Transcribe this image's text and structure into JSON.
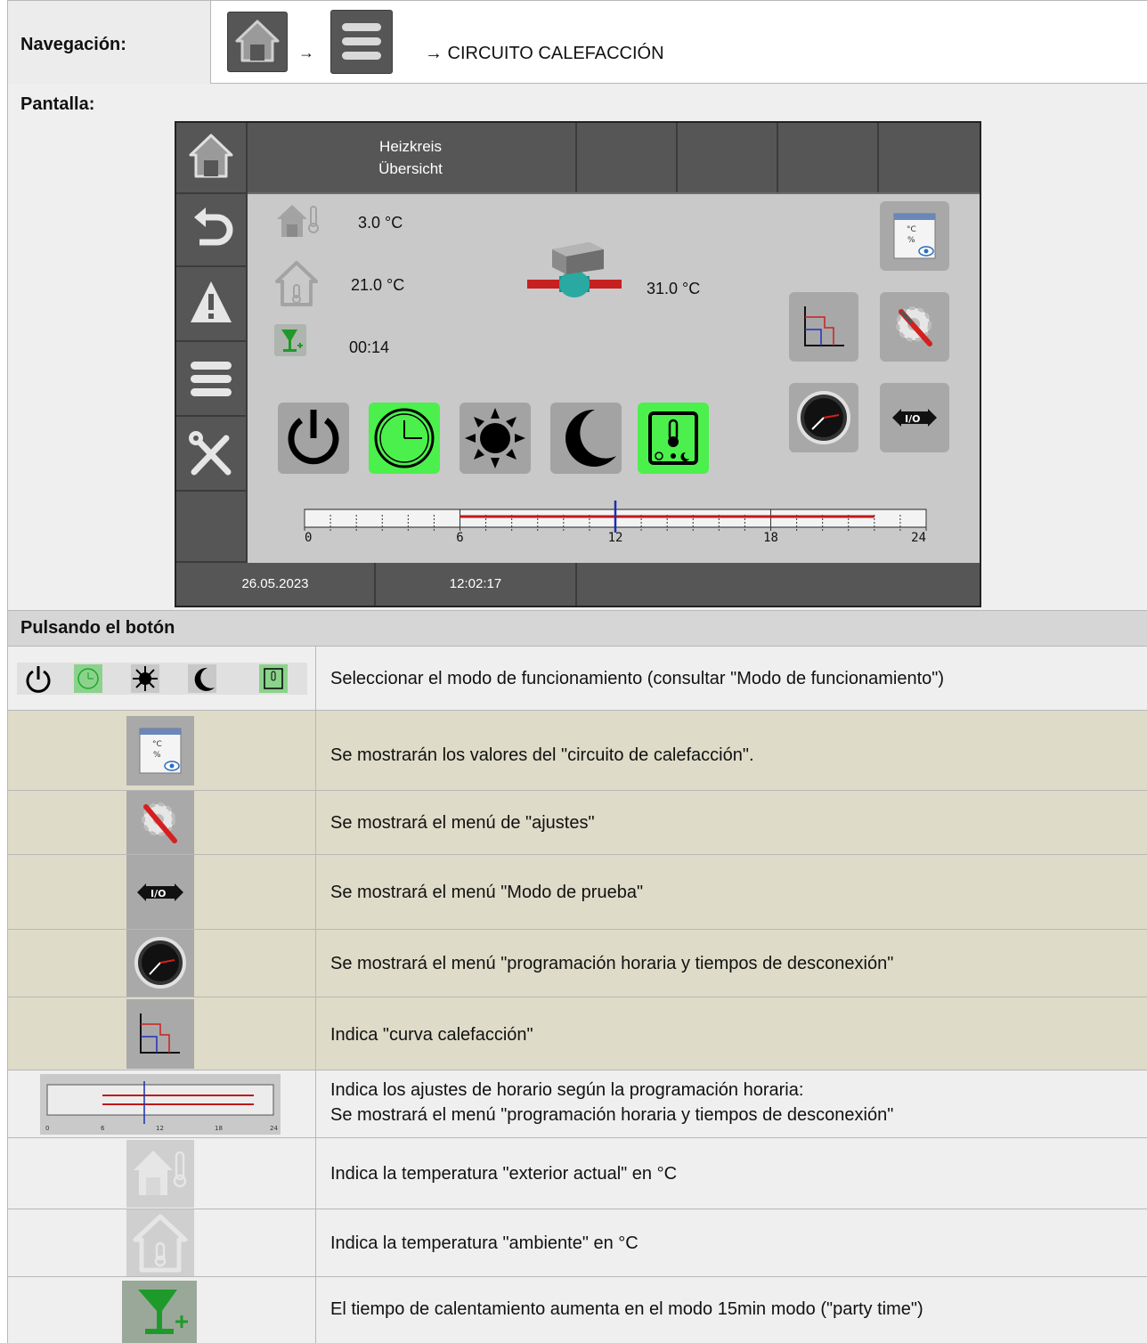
{
  "navigation": {
    "label": "Navegación:",
    "arrow1": "→",
    "arrow2": "→",
    "destination": "→ CIRCUITO CALEFACCIÓN",
    "home_button_icon": "home-icon",
    "menu_button_icon": "hamburger-menu-icon"
  },
  "screen": {
    "label": "Pantalla:",
    "title_line1": "Heizkreis",
    "title_line2": "Übersicht",
    "outdoor_temp": "3.0  °C",
    "room_temp": "21.0  °C",
    "flow_temp": "31.0 °C",
    "party_time": "00:14",
    "date": "26.05.2023",
    "time": "12:02:17",
    "timeline": {
      "ticks": [
        "0",
        "6",
        "12",
        "18",
        "24"
      ],
      "on_from_hour": 6,
      "on_to_hour": 22,
      "current_hour": 12
    },
    "active_mode_color": "#4cf04c",
    "bar_color": "#c01818",
    "marker_color": "#1a2fb0"
  },
  "table": {
    "header": "Pulsando el botón",
    "rows": [
      {
        "icon": "mode-buttons",
        "text": "Seleccionar el modo de funcionamiento (consultar \"Modo de funcionamiento\")"
      },
      {
        "icon": "values-view-icon",
        "text": "Se mostrarán los valores del \"circuito de calefacción\"."
      },
      {
        "icon": "settings-icon",
        "text": "Se mostrará el menú de \"ajustes\""
      },
      {
        "icon": "test-mode-icon",
        "text": "Se mostrará el menú \"Modo de prueba\""
      },
      {
        "icon": "clock-icon",
        "text": "Se mostrará el menú \"programación horaria y tiempos de desconexión\""
      },
      {
        "icon": "heating-curve-icon",
        "text": "Indica \"curva calefacción\""
      },
      {
        "icon": "timeline-icon",
        "text_line1": "Indica los ajustes de horario según la programación horaria:",
        "text_line2": "Se mostrará el menú \"programación horaria y tiempos de desconexión\""
      },
      {
        "icon": "outdoor-temp-icon",
        "text": "Indica la temperatura \"exterior actual\" en °C"
      },
      {
        "icon": "room-temp-icon",
        "text": "Indica la temperatura \"ambiente\" en °C"
      },
      {
        "icon": "party-time-icon",
        "text": "El tiempo de calentamiento aumenta en el modo 15min modo (\"party time\")"
      }
    ]
  }
}
